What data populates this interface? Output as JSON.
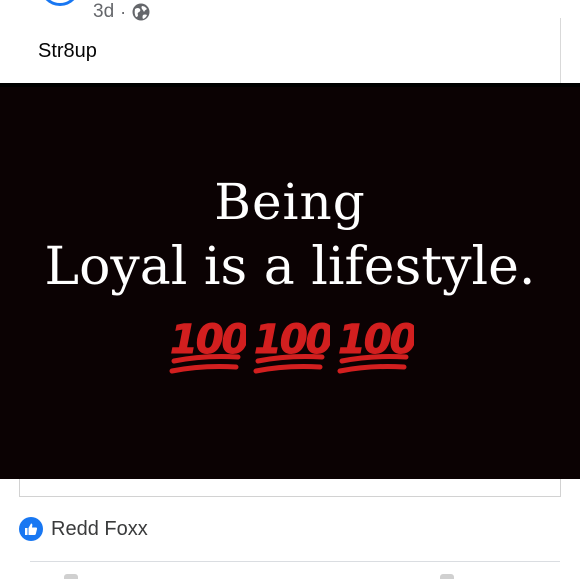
{
  "post": {
    "age": "3d",
    "separator": "·",
    "privacy_icon": "globe-icon",
    "text": "Str8up"
  },
  "image": {
    "line1": "Being",
    "line2": "Loyal is a lifestyle.",
    "emoji": "100-emoji",
    "emoji_count": 3,
    "emoji_color": "#d21f1f",
    "background": "#0b0203"
  },
  "reactions": {
    "icon": "thumbs-up-icon",
    "names": "Redd Foxx"
  },
  "colors": {
    "accent": "#1877f2"
  }
}
